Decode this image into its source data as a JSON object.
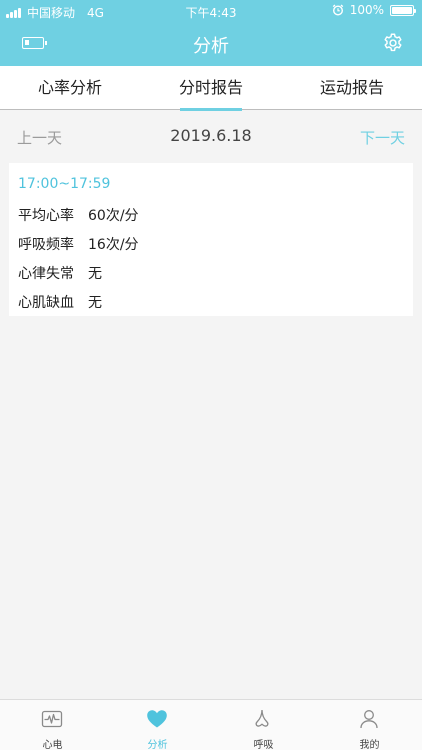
{
  "status_bar": {
    "carrier": "中国移动",
    "network": "4G",
    "time": "下午4:43",
    "battery_percent": "100%"
  },
  "nav": {
    "title": "分析",
    "device_battery_level": 0.25
  },
  "tabs": [
    {
      "label": "心率分析",
      "active": false
    },
    {
      "label": "分时报告",
      "active": true
    },
    {
      "label": "运动报告",
      "active": false
    }
  ],
  "day_nav": {
    "prev": "上一天",
    "date": "2019.6.18",
    "next": "下一天"
  },
  "report": {
    "time_range": "17:00~17:59",
    "rows": [
      {
        "label": "平均心率",
        "value": "60次/分"
      },
      {
        "label": "呼吸频率",
        "value": "16次/分"
      },
      {
        "label": "心律失常",
        "value": "无"
      },
      {
        "label": "心肌缺血",
        "value": "无"
      }
    ]
  },
  "tabbar": [
    {
      "label": "心电",
      "icon": "ecg-monitor-icon",
      "active": false
    },
    {
      "label": "分析",
      "icon": "heart-icon",
      "active": true
    },
    {
      "label": "呼吸",
      "icon": "nose-icon",
      "active": false
    },
    {
      "label": "我的",
      "icon": "person-icon",
      "active": false
    }
  ],
  "colors": {
    "accent": "#6fd0e2",
    "accent_text": "#4fc3dd",
    "background": "#f4f4f4"
  }
}
